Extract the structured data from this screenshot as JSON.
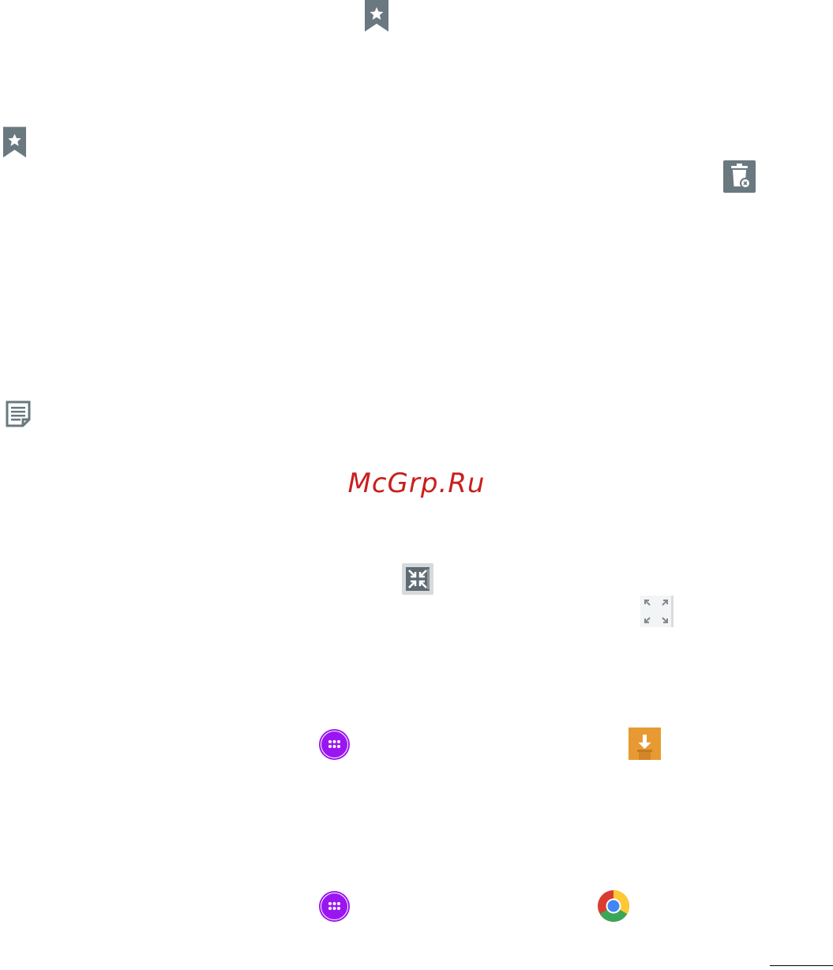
{
  "watermark": {
    "text": "McGrp.Ru"
  },
  "colors": {
    "icon_gray": "#6a7880",
    "watermark_red": "#c8201e",
    "apps_purple": "#9a16f0",
    "download_orange": "#e79a32",
    "rule": "#000000"
  },
  "icons": [
    "bookmark-icon",
    "bookmark-icon",
    "trash-delete-icon",
    "note-icon",
    "collapse-window-icon",
    "expand-fullscreen-icon",
    "apps-icon",
    "download-icon",
    "apps-icon",
    "chrome-icon"
  ]
}
